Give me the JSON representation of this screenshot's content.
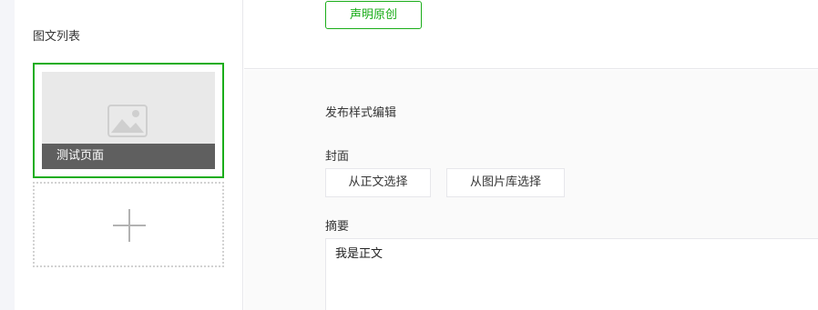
{
  "sidebar": {
    "title": "图文列表",
    "articles": [
      {
        "title": "测试页面",
        "cover_icon": "image-placeholder-icon"
      }
    ],
    "add_icon": "plus-icon"
  },
  "main": {
    "declare_original_label": "声明原创",
    "publish_style_label": "发布样式编辑",
    "cover": {
      "label": "封面",
      "from_body_label": "从正文选择",
      "from_library_label": "从图片库选择"
    },
    "summary": {
      "label": "摘要",
      "value": "我是正文"
    }
  },
  "colors": {
    "accent": "#1aad19",
    "border": "#e7e7eb",
    "page_bg": "#f4f5f9",
    "cover_title_bg": "#5f5f5f"
  }
}
